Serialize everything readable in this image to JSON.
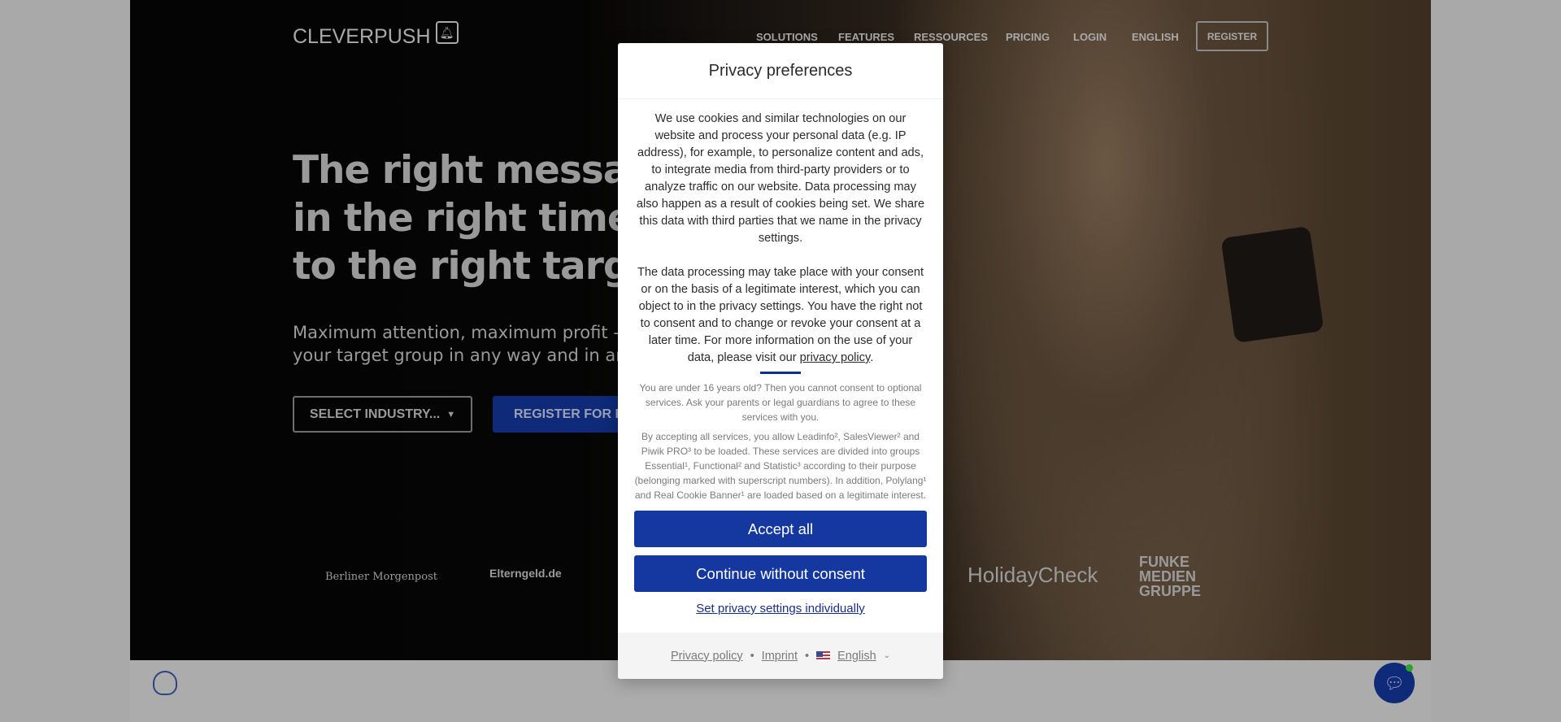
{
  "header": {
    "logo": "CLEVERPUSH",
    "nav": [
      "SOLUTIONS",
      "FEATURES",
      "RESSOURCES",
      "PRICING",
      "LOGIN",
      "ENGLISH"
    ],
    "register": "REGISTER"
  },
  "hero": {
    "title_lines": [
      "The right message",
      "in the right time",
      "to the right target g"
    ],
    "subtitle_lines": [
      "Maximum attention, maximum profit - with",
      "your target group in any way and in an inte"
    ],
    "select_industry": "SELECT INDUSTRY...",
    "register_free": "REGISTER FOR FR"
  },
  "partners": [
    "Berliner Morgenpost",
    "Elterngeld.de",
    "HolidayCheck",
    "FUNKE MEDIEN GRUPPE"
  ],
  "modal": {
    "title": "Privacy preferences",
    "p1": "We use cookies and similar technologies on our website and process your personal data (e.g. IP address), for example, to personalize content and ads, to integrate media from third-party providers or to analyze traffic on our website. Data processing may also happen as a result of cookies being set. We share this data with third parties that we name in the privacy settings.",
    "p2": "The data processing may take place with your consent or on the basis of a legitimate interest, which you can object to in the privacy settings. You have the right not to consent and to change or revoke your consent at a later time. For more information on the use of your data, please visit our",
    "p2_link": "privacy policy",
    "age_notice": "You are under 16 years old? Then you cannot consent to optional services. Ask your parents or legal guardians to agree to these services with you.",
    "services_notice": "By accepting all services, you allow Leadinfo², SalesViewer² and Piwik PRO³ to be loaded. These services are divided into groups Essential¹, Functional² and Statistic³ according to their purpose (belonging marked with superscript numbers). In addition, Polylang¹ and Real Cookie Banner¹ are loaded based on a legitimate interest.",
    "accept_all": "Accept all",
    "continue_without": "Continue without consent",
    "individual": "Set privacy settings individually",
    "footer": {
      "privacy": "Privacy policy",
      "imprint": "Imprint",
      "language": "English",
      "separator": "•"
    }
  },
  "colors": {
    "primary": "#1537a0",
    "overlay": "rgba(0,0,0,0.33)"
  }
}
